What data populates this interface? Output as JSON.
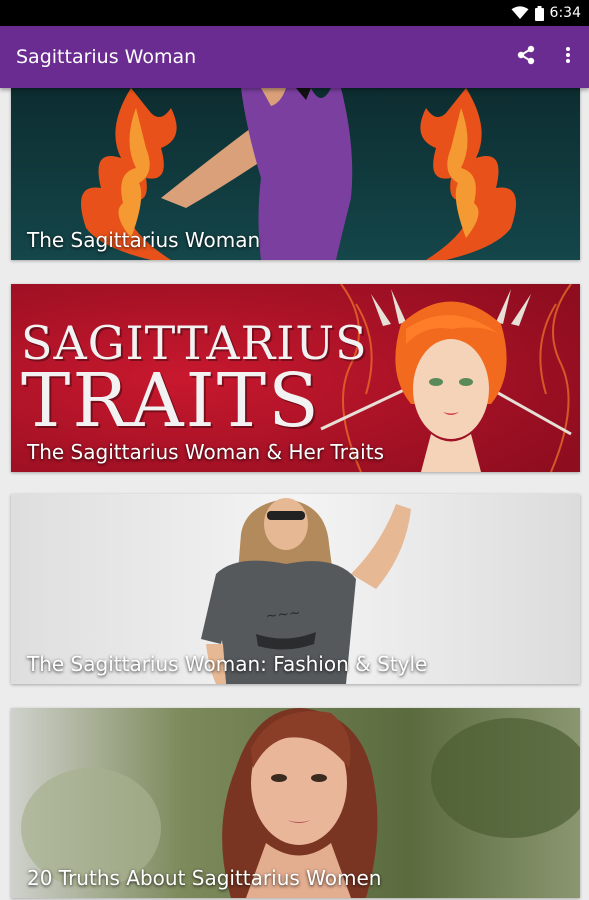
{
  "status_bar": {
    "time": "6:34",
    "icons": [
      "wifi-icon",
      "battery-icon"
    ]
  },
  "app_bar": {
    "title": "Sagittarius Woman",
    "actions": [
      "share-icon",
      "more-vert-icon"
    ],
    "color": "#6a2c91"
  },
  "articles": [
    {
      "caption": "The Sagittarius Woman"
    },
    {
      "caption": "The Sagittarius Woman & Her Traits",
      "banner_line1": "SAGITTARIUS",
      "banner_line2": "TRAITS"
    },
    {
      "caption": "The Sagittarius Woman: Fashion & Style"
    },
    {
      "caption": "20 Truths About Sagittarius Women"
    }
  ]
}
